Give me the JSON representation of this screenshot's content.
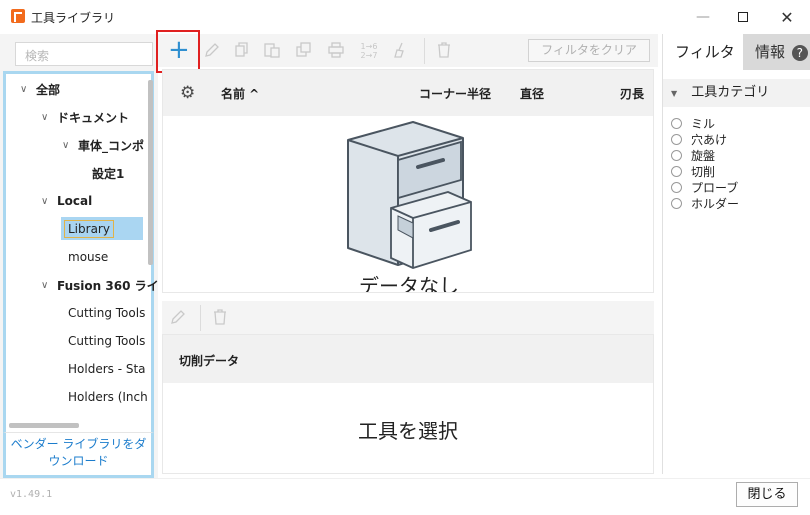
{
  "window": {
    "title": "工具ライブラリ",
    "minimize_label": "—",
    "close_label": "✕"
  },
  "left": {
    "search_placeholder": "検索",
    "tree": [
      {
        "label": "全部",
        "chevron": "∨"
      },
      {
        "label": "ドキュメント",
        "chevron": "∨"
      },
      {
        "label": "車体_コンポ",
        "chevron": "∨"
      },
      {
        "label": "設定1",
        "chevron": ""
      },
      {
        "label": "Local",
        "chevron": "∨"
      },
      {
        "label": "Library",
        "chevron": ""
      },
      {
        "label": "mouse",
        "chevron": ""
      },
      {
        "label": "Fusion 360 ライ",
        "chevron": "∨"
      },
      {
        "label": "Cutting Tools",
        "chevron": ""
      },
      {
        "label": "Cutting Tools",
        "chevron": ""
      },
      {
        "label": "Holders - Sta",
        "chevron": ""
      },
      {
        "label": "Holders (Inch",
        "chevron": ""
      }
    ],
    "vendor_link_line1": "ベンダー ライブラリをダ",
    "vendor_link_line2": "ウンロード"
  },
  "toolbar": {
    "add": "+",
    "renumber_label": "1→6 2→7",
    "filter_clear": "フィルタをクリア"
  },
  "grid": {
    "columns": [
      "名前 ^",
      "コーナー半径",
      "直径",
      "刃長"
    ],
    "empty_text": "データなし"
  },
  "cutting": {
    "header": "切削データ",
    "empty_text": "工具を選択"
  },
  "right": {
    "tab_filter": "フィルタ",
    "tab_info": "情報",
    "help": "?",
    "category_header": "工具カテゴリ",
    "categories": [
      "ミル",
      "穴あけ",
      "旋盤",
      "切削",
      "プローブ",
      "ホルダー"
    ]
  },
  "footer": {
    "version": "v1.49.1",
    "close_button": "閉じる"
  }
}
